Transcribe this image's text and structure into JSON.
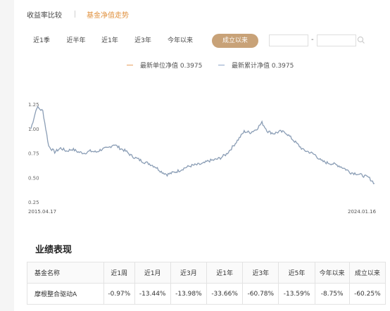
{
  "tabs": [
    {
      "label": "收益率比较",
      "active": false
    },
    {
      "label": "基金净值走势",
      "active": true
    }
  ],
  "ranges": [
    {
      "label": "近1季",
      "active": false
    },
    {
      "label": "近半年",
      "active": false
    },
    {
      "label": "近1年",
      "active": false
    },
    {
      "label": "近3年",
      "active": false
    },
    {
      "label": "今年以来",
      "active": false
    },
    {
      "label": "成立以来",
      "active": true
    }
  ],
  "date_range": {
    "start_value": "",
    "end_value": "",
    "separator": "-"
  },
  "legend": {
    "unit_nav": "最新单位净值 0.3975",
    "cum_nav": "最新累计净值 0.3975"
  },
  "colors": {
    "accent": "#e0913e",
    "active_pill": "#c8a278",
    "line": "#8a9db5",
    "unit_swatch": "#e8a060",
    "cum_swatch": "#8ea5c8"
  },
  "chart_data": {
    "type": "line",
    "title": "",
    "xlabel": "",
    "ylabel": "",
    "x_start": "2015.04.17",
    "x_end": "2024.01.16",
    "yticks": [
      "1.25",
      "1.00",
      "0.75",
      "0.50",
      "0.25"
    ],
    "ylim": [
      0.25,
      1.25
    ],
    "grid": false,
    "series": [
      {
        "values": [
          1.0,
          1.22,
          1.18,
          0.82,
          0.76,
          0.8,
          0.77,
          0.79,
          0.76,
          0.75,
          0.77,
          0.76,
          0.79,
          0.8,
          0.84,
          0.8,
          0.77,
          0.72,
          0.69,
          0.66,
          0.64,
          0.61,
          0.56,
          0.53,
          0.55,
          0.57,
          0.6,
          0.62,
          0.63,
          0.64,
          0.67,
          0.68,
          0.7,
          0.74,
          0.81,
          0.89,
          0.97,
          0.96,
          0.99,
          1.06,
          0.97,
          0.95,
          0.97,
          0.96,
          0.9,
          0.84,
          0.78,
          0.76,
          0.73,
          0.67,
          0.65,
          0.64,
          0.62,
          0.59,
          0.55,
          0.54,
          0.52,
          0.5,
          0.44
        ]
      }
    ]
  },
  "performance": {
    "title": "业绩表现",
    "headers": [
      "基金名称",
      "近1周",
      "近1月",
      "近3月",
      "近1年",
      "近3年",
      "近5年",
      "今年以来",
      "成立以来"
    ],
    "rows": [
      [
        "摩根整合驱动A",
        "-0.97%",
        "-13.44%",
        "-13.98%",
        "-33.66%",
        "-60.78%",
        "-13.59%",
        "-8.75%",
        "-60.25%"
      ]
    ]
  }
}
